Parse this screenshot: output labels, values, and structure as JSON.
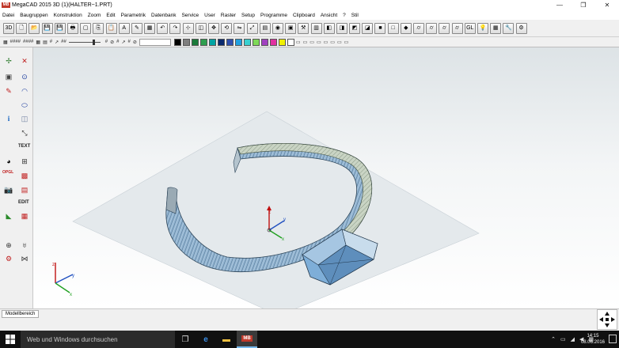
{
  "window": {
    "title": "MegaCAD 2015 3D (1)(HALTER~1.PRT)",
    "logo_text": "MB",
    "minimize": "—",
    "maximize": "❐",
    "close": "✕"
  },
  "menu": [
    "Datei",
    "Baugruppen",
    "Konstruktion",
    "Zoom",
    "Edit",
    "Parametrik",
    "Datenbank",
    "Service",
    "User",
    "Raster",
    "Setup",
    "Programme",
    "Clipboard",
    "Ansicht",
    "?",
    "Stil"
  ],
  "toolbar_main": [
    {
      "name": "3d-mode-icon",
      "glyph": "3D"
    },
    {
      "name": "new-file-icon",
      "glyph": "🗋"
    },
    {
      "name": "open-file-icon",
      "glyph": "📂"
    },
    {
      "name": "save-icon",
      "glyph": "💾"
    },
    {
      "name": "save-as-icon",
      "glyph": "💾"
    },
    {
      "name": "print-icon",
      "glyph": "🖶"
    },
    {
      "name": "redraw-icon",
      "glyph": "▢"
    },
    {
      "name": "copy-icon",
      "glyph": "⎘"
    },
    {
      "name": "paste-icon",
      "glyph": "📋"
    },
    {
      "name": "text-icon",
      "glyph": "A"
    },
    {
      "name": "pen-icon",
      "glyph": "✎"
    },
    {
      "name": "measure-icon",
      "glyph": "▦"
    },
    {
      "name": "undo-icon",
      "glyph": "↶"
    },
    {
      "name": "redo-icon",
      "glyph": "↷"
    },
    {
      "name": "axes-icon",
      "glyph": "⊹"
    },
    {
      "name": "box-icon",
      "glyph": "◫"
    },
    {
      "name": "move-icon",
      "glyph": "✥"
    },
    {
      "name": "rotate-icon",
      "glyph": "⟲"
    },
    {
      "name": "mirror-icon",
      "glyph": "⇋"
    },
    {
      "name": "scale-icon",
      "glyph": "⤢"
    },
    {
      "name": "hatch-icon",
      "glyph": "▤"
    },
    {
      "name": "view-icon",
      "glyph": "◉"
    },
    {
      "name": "layer-icon",
      "glyph": "▣"
    },
    {
      "name": "tools-icon",
      "glyph": "⚒"
    },
    {
      "name": "calc-icon",
      "glyph": "▥"
    },
    {
      "name": "cube-front-icon",
      "glyph": "◧"
    },
    {
      "name": "cube-top-icon",
      "glyph": "◨"
    },
    {
      "name": "cube-side-icon",
      "glyph": "◩"
    },
    {
      "name": "cube-iso-icon",
      "glyph": "◪"
    },
    {
      "name": "cube-shaded-icon",
      "glyph": "■"
    },
    {
      "name": "cube-wire-icon",
      "glyph": "□"
    },
    {
      "name": "render-icon",
      "glyph": "◆"
    },
    {
      "name": "cylinder-icon",
      "glyph": "⌭"
    },
    {
      "name": "cylinder2-icon",
      "glyph": "⌭"
    },
    {
      "name": "cylinder3-icon",
      "glyph": "⌭"
    },
    {
      "name": "cylinder4-icon",
      "glyph": "⌭"
    },
    {
      "name": "opengl-icon",
      "glyph": "GL"
    },
    {
      "name": "lamp-icon",
      "glyph": "💡"
    },
    {
      "name": "grid-icon",
      "glyph": "▦"
    },
    {
      "name": "tools2-icon",
      "glyph": "🔧"
    },
    {
      "name": "settings-icon",
      "glyph": "⚙"
    }
  ],
  "toolbar_secondary": {
    "items_left": [
      "▦",
      "####",
      "####",
      "▦",
      "▤",
      "#",
      "↗",
      "##"
    ],
    "items_right": [
      "#",
      "⊘",
      "#",
      "↗",
      "#",
      "⊘"
    ],
    "swatches": [
      "#000000",
      "#7f7f7f",
      "#1a7a3a",
      "#2e9e4e",
      "#00a3a3",
      "#0a2a6e",
      "#3050b0",
      "#20a0e0",
      "#3ad0d0",
      "#7ed957",
      "#a040c0",
      "#e030a0",
      "#f0f000",
      "#ffffff"
    ],
    "right_icons": [
      "▭",
      "▭",
      "▭",
      "▭",
      "▭",
      "▭",
      "▭",
      "▭"
    ]
  },
  "left_toolbar": {
    "text_label": "TEXT",
    "edit_label": "EDIT",
    "opengl_label": "OPGL"
  },
  "statusbar": {
    "tab_label": "Modellbereich"
  },
  "taskbar": {
    "search_placeholder": "Web und Windows durchsuchen",
    "time": "14:15",
    "date": "08.06.2016"
  }
}
